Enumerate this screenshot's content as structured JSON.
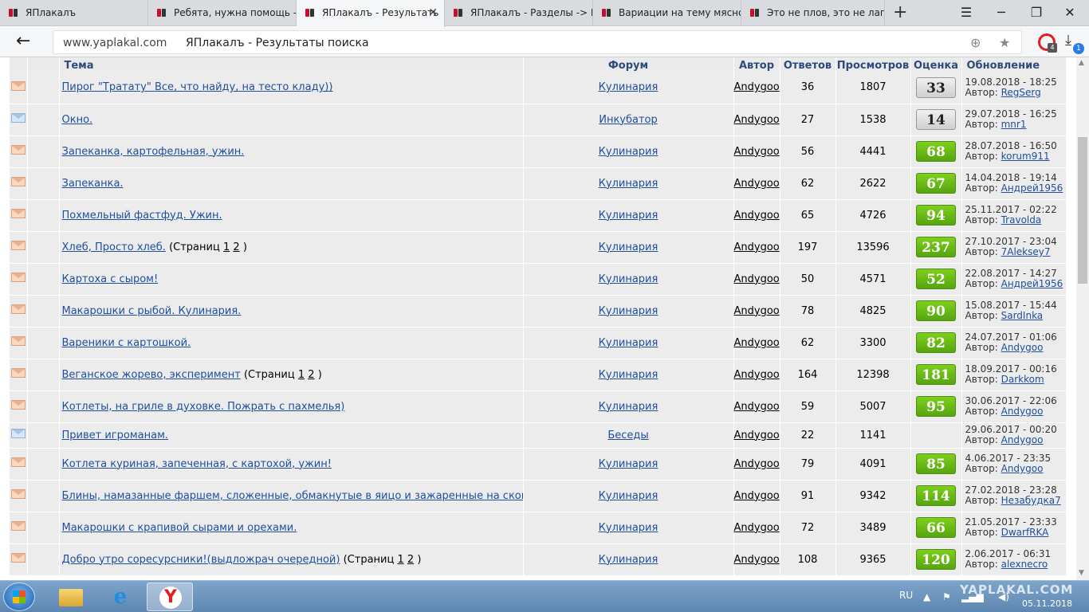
{
  "tabs": [
    {
      "title": "ЯПлакалъ",
      "active": false
    },
    {
      "title": "Ребята, нужна помощь -",
      "active": false
    },
    {
      "title": "ЯПлакалъ - Результать",
      "active": true
    },
    {
      "title": "ЯПлакалъ - Разделы -> К",
      "active": false
    },
    {
      "title": "Вариации на тему мясно",
      "active": false
    },
    {
      "title": "Это не плов, это не лагм",
      "active": false
    }
  ],
  "address": {
    "host": "www.yaplakal.com",
    "page_title": "ЯПлакалъ - Результаты поиска",
    "ext_badge": "4",
    "downloads_badge": "1"
  },
  "table": {
    "headers": {
      "topic": "Тема",
      "forum": "Форум",
      "author": "Автор",
      "replies": "Ответов",
      "views": "Просмотров",
      "rating": "Оценка",
      "updated": "Обновление"
    },
    "author_prefix": "Автор:",
    "pages_label": "(Страниц",
    "pages_close": ")",
    "rows": [
      {
        "icon": "orange",
        "topic": "Пирог \"Тратату\" Все, что найду, на тесто кладу))",
        "forum": "Кулинария",
        "author": "Andygoo",
        "replies": "36",
        "views": "1807",
        "rating": "33",
        "rating_style": "grey",
        "date": "19.08.2018 - 18:25",
        "last_author": "RegSerg"
      },
      {
        "icon": "blue",
        "topic": "Окно.",
        "forum": "Инкубатор",
        "author": "Andygoo",
        "replies": "27",
        "views": "1538",
        "rating": "14",
        "rating_style": "grey",
        "date": "29.07.2018 - 16:25",
        "last_author": "mnr1"
      },
      {
        "icon": "orange",
        "topic": "Запеканка, картофельная, ужин.",
        "forum": "Кулинария",
        "author": "Andygoo",
        "replies": "56",
        "views": "4441",
        "rating": "68",
        "rating_style": "green",
        "date": "28.07.2018 - 16:50",
        "last_author": "korum911"
      },
      {
        "icon": "orange",
        "topic": "Запеканка.",
        "forum": "Кулинария",
        "author": "Andygoo",
        "replies": "62",
        "views": "2622",
        "rating": "67",
        "rating_style": "green",
        "date": "14.04.2018 - 19:14",
        "last_author": "Андрей1956"
      },
      {
        "icon": "orange",
        "topic": "Похмельный фастфуд. Ужин.",
        "forum": "Кулинария",
        "author": "Andygoo",
        "replies": "65",
        "views": "4726",
        "rating": "94",
        "rating_style": "green",
        "date": "25.11.2017 - 02:22",
        "last_author": "Travolda"
      },
      {
        "icon": "orange",
        "topic": "Хлеб, Просто хлеб.",
        "pages": [
          "1",
          "2"
        ],
        "forum": "Кулинария",
        "author": "Andygoo",
        "replies": "197",
        "views": "13596",
        "rating": "237",
        "rating_style": "green",
        "date": "27.10.2017 - 23:04",
        "last_author": "7Aleksey7"
      },
      {
        "icon": "orange",
        "topic": "Картоха с сыром!",
        "forum": "Кулинария",
        "author": "Andygoo",
        "replies": "50",
        "views": "4571",
        "rating": "52",
        "rating_style": "green",
        "date": "22.08.2017 - 14:27",
        "last_author": "Андрей1956"
      },
      {
        "icon": "orange",
        "topic": "Макарошки с рыбой. Кулинария.",
        "forum": "Кулинария",
        "author": "Andygoo",
        "replies": "78",
        "views": "4825",
        "rating": "90",
        "rating_style": "green",
        "date": "15.08.2017 - 15:44",
        "last_author": "SardInka"
      },
      {
        "icon": "orange",
        "topic": "Вареники с картошкой.",
        "forum": "Кулинария",
        "author": "Andygoo",
        "replies": "62",
        "views": "3300",
        "rating": "82",
        "rating_style": "green",
        "date": "24.07.2017 - 01:06",
        "last_author": "Andygoo"
      },
      {
        "icon": "orange",
        "topic": "Веганское жорево, эксперимент",
        "pages": [
          "1",
          "2"
        ],
        "forum": "Кулинария",
        "author": "Andygoo",
        "replies": "164",
        "views": "12398",
        "rating": "181",
        "rating_style": "green",
        "date": "18.09.2017 - 00:16",
        "last_author": "Darkkom"
      },
      {
        "icon": "orange",
        "topic": "Котлеты, на гриле в духовке. Пожрать с пахмелья)",
        "forum": "Кулинария",
        "author": "Andygoo",
        "replies": "59",
        "views": "5007",
        "rating": "95",
        "rating_style": "green",
        "date": "30.06.2017 - 22:06",
        "last_author": "Andygoo"
      },
      {
        "icon": "blue",
        "topic": "Привет игроманам.",
        "forum": "Беседы",
        "author": "Andygoo",
        "replies": "22",
        "views": "1141",
        "rating": "",
        "rating_style": "none",
        "date": "29.06.2017 - 00:20",
        "last_author": "Andygoo",
        "short": true
      },
      {
        "icon": "orange",
        "topic": "Котлета куриная, запеченная, с картохой, ужин!",
        "forum": "Кулинария",
        "author": "Andygoo",
        "replies": "79",
        "views": "4091",
        "rating": "85",
        "rating_style": "green",
        "date": "4.06.2017 - 23:35",
        "last_author": "Andygoo"
      },
      {
        "icon": "orange",
        "topic": "Блины, намазанные фаршем, сложенные, обмакнутые в яицо и зажаренные на сковородке",
        "forum": "Кулинария",
        "author": "Andygoo",
        "replies": "91",
        "views": "9342",
        "rating": "114",
        "rating_style": "green",
        "date": "27.02.2018 - 23:28",
        "last_author": "Незабудка7"
      },
      {
        "icon": "orange",
        "topic": "Макарошки с крапивой сырами и орехами.",
        "forum": "Кулинария",
        "author": "Andygoo",
        "replies": "72",
        "views": "3489",
        "rating": "66",
        "rating_style": "green",
        "date": "21.05.2017 - 23:33",
        "last_author": "DwarfRKA"
      },
      {
        "icon": "orange",
        "topic": "Добро утро соресурсники!(выдложрач очередной)",
        "pages": [
          "1",
          "2"
        ],
        "forum": "Кулинария",
        "author": "Andygoo",
        "replies": "108",
        "views": "9365",
        "rating": "120",
        "rating_style": "green",
        "date": "2.06.2017 - 06:31",
        "last_author": "alexnecro"
      }
    ]
  },
  "taskbar": {
    "lang": "RU",
    "date": "05.11.2018",
    "watermark": "YAPLAKAL.COM",
    "yandex_glyph": "Y"
  },
  "colors": {
    "rating_green": "#6bbd16",
    "link": "#1f4e9c",
    "header_text": "#2d4a7a"
  }
}
